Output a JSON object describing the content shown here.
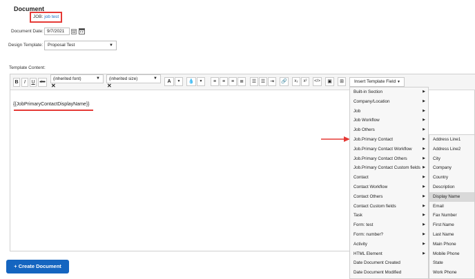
{
  "header": {
    "title": "Document"
  },
  "job": {
    "label": "JOB:",
    "value": "job test"
  },
  "form": {
    "document_date_label": "Document Date:",
    "document_date_value": "9/7/2021",
    "design_template_label": "Design Template:",
    "design_template_value": "Proposal Test",
    "template_content_label": "Template Content:"
  },
  "toolbar": {
    "bold": "B",
    "italic": "I",
    "underline": "U",
    "strike": "abc",
    "font_family": "(inherited font)",
    "font_size": "(inherited size)",
    "font_color": "A",
    "subscript": "x₂",
    "superscript": "x²",
    "insert_template_field": "Insert Template Field"
  },
  "editor": {
    "content": "{{JobPrimaryContactDisplayName}}"
  },
  "menu": {
    "items": [
      "Built-in Section",
      "Company/Location",
      "Job",
      "Job Workflow",
      "Job Others",
      "Job.Primary Contact",
      "Job.Primary Contact Workflow",
      "Job.Primary Contact Others",
      "Job.Primary Contact Custom fields",
      "Contact",
      "Contact Workflow",
      "Contact Others",
      "Contact Custom fields",
      "Task",
      "Form: test",
      "Form: number?",
      "Activity",
      "HTML Element",
      "Date Document Created",
      "Date Document Modified"
    ]
  },
  "submenu": {
    "items": [
      "Address Line1",
      "Address Line2",
      "City",
      "Company",
      "Country",
      "Description",
      "Display Name",
      "Email",
      "Fax Number",
      "First Name",
      "Last Name",
      "Main Phone",
      "Mobile Phone",
      "State",
      "Work Phone"
    ]
  },
  "actions": {
    "create_document": "Create Document",
    "create_plus": "+"
  },
  "colors": {
    "accent": "#1565c0",
    "highlight": "#e53935"
  }
}
